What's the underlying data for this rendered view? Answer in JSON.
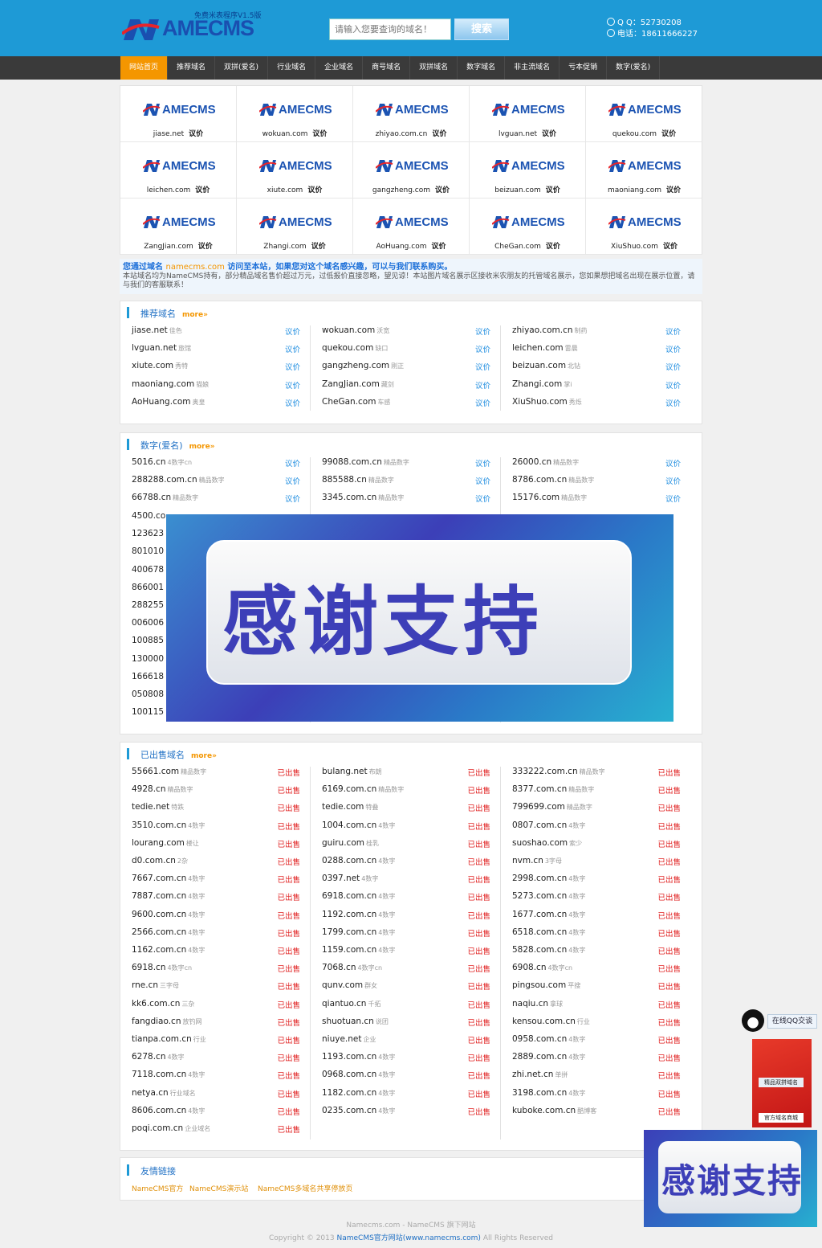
{
  "header": {
    "logo_sub": "免费米表程序V1.5版",
    "logo_text": "AMECMS",
    "search_placeholder": "请输入您要查询的域名！",
    "search_button": "搜索",
    "qq": "Q Q：52730208",
    "phone": "电话：18611666227"
  },
  "nav": [
    "网站首页",
    "推荐域名",
    "双拼(爱名)",
    "行业域名",
    "企业域名",
    "商号域名",
    "双拼域名",
    "数字域名",
    "非主流域名",
    "亏本促销",
    "数字(爱名)"
  ],
  "featured_logo": "AMECMS",
  "featured_price": "议价",
  "featured": [
    "jiase.net",
    "wokuan.com",
    "zhiyao.com.cn",
    "lvguan.net",
    "quekou.com",
    "leichen.com",
    "xiute.com",
    "gangzheng.com",
    "beizuan.com",
    "maoniang.com",
    "ZangJian.com",
    "Zhangi.com",
    "AoHuang.com",
    "CheGan.com",
    "XiuShuo.com"
  ],
  "notice": {
    "l1_a": "您通过域名",
    "l1_hl": "namecms.com",
    "l1_b": "访问至本站，如果您对这个域名感兴趣，可以与我们联系购买。",
    "l2": "本站域名均为NameCMS持有，部分精品域名售价超过万元，过低报价直接忽略，望见谅！本站图片域名展示区接收米农朋友的托管域名展示，您如果想把域名出现在展示位置，请与我们的客服联系！"
  },
  "recommended": {
    "title": "推荐域名",
    "more": "more»",
    "price": "议价",
    "rows": [
      [
        "jiase.net",
        "佳色",
        "wokuan.com",
        "沃宽",
        "zhiyao.com.cn",
        "制药"
      ],
      [
        "lvguan.net",
        "旅馆",
        "quekou.com",
        "缺口",
        "leichen.com",
        "雷晨"
      ],
      [
        "xiute.com",
        "秀特",
        "gangzheng.com",
        "刚正",
        "beizuan.com",
        "北钻"
      ],
      [
        "maoniang.com",
        "猫娘",
        "ZangJian.com",
        "藏剑",
        "Zhangi.com",
        "掌i"
      ],
      [
        "AoHuang.com",
        "奥皇",
        "CheGan.com",
        "车感",
        "XiuShuo.com",
        "秀烁"
      ]
    ]
  },
  "numeric": {
    "title": "数字(爱名)",
    "more": "more»",
    "price": "议价",
    "rows": [
      [
        "5016.cn",
        "4数字cn",
        "99088.com.cn",
        "精品数字",
        "26000.cn",
        "精品数字"
      ],
      [
        "288288.com.cn",
        "精品数字",
        "885588.cn",
        "精品数字",
        "8786.com.cn",
        "精品数字"
      ],
      [
        "66788.cn",
        "精品数字",
        "3345.com.cn",
        "精品数字",
        "15176.com",
        "精品数字"
      ]
    ],
    "partial": [
      "4500.co",
      "123623",
      "801010",
      "400678",
      "866001",
      "288255",
      "006006",
      "100885",
      "130000",
      "166618",
      "050808",
      "100115"
    ]
  },
  "overlay_text": "感谢支持",
  "sold": {
    "title": "已出售域名",
    "more": "more»",
    "status": "已出售",
    "col1": [
      [
        "55661.com",
        "精品数字"
      ],
      [
        "4928.cn",
        "精品数字"
      ],
      [
        "tedie.net",
        "特跌"
      ],
      [
        "3510.com.cn",
        "4数字"
      ],
      [
        "lourang.com",
        "楼让"
      ],
      [
        "d0.com.cn",
        "2杂"
      ],
      [
        "7667.com.cn",
        "4数字"
      ],
      [
        "7887.com.cn",
        "4数字"
      ],
      [
        "9600.com.cn",
        "4数字"
      ],
      [
        "2566.com.cn",
        "4数字"
      ],
      [
        "1162.com.cn",
        "4数字"
      ],
      [
        "6918.cn",
        "4数字cn"
      ],
      [
        "rne.cn",
        "三字母"
      ],
      [
        "kk6.com.cn",
        "三杂"
      ],
      [
        "fangdiao.cn",
        "放钓网"
      ],
      [
        "tianpa.com.cn",
        "行业"
      ],
      [
        "6278.cn",
        "4数字"
      ],
      [
        "7118.com.cn",
        "4数字"
      ],
      [
        "netya.cn",
        "行业域名"
      ],
      [
        "8606.com.cn",
        "4数字"
      ],
      [
        "poqi.com.cn",
        "企业域名"
      ]
    ],
    "col2": [
      [
        "bulang.net",
        "布朗"
      ],
      [
        "6169.com.cn",
        "精品数字"
      ],
      [
        "tedie.com",
        "特叠"
      ],
      [
        "1004.com.cn",
        "4数字"
      ],
      [
        "guiru.com",
        "桂乳"
      ],
      [
        "0288.com.cn",
        "4数字"
      ],
      [
        "0397.net",
        "4数字"
      ],
      [
        "6918.com.cn",
        "4数字"
      ],
      [
        "1192.com.cn",
        "4数字"
      ],
      [
        "1799.com.cn",
        "4数字"
      ],
      [
        "1159.com.cn",
        "4数字"
      ],
      [
        "7068.cn",
        "4数字cn"
      ],
      [
        "qunv.com",
        "群女"
      ],
      [
        "qiantuo.cn",
        "千拓"
      ],
      [
        "shuotuan.cn",
        "说团"
      ],
      [
        "niuye.net",
        "企业"
      ],
      [
        "1193.com.cn",
        "4数字"
      ],
      [
        "0968.com.cn",
        "4数字"
      ],
      [
        "1182.com.cn",
        "4数字"
      ],
      [
        "0235.com.cn",
        "4数字"
      ]
    ],
    "col3": [
      [
        "333222.com.cn",
        "精品数字"
      ],
      [
        "8377.com.cn",
        "精品数字"
      ],
      [
        "799699.com",
        "精品数字"
      ],
      [
        "0807.com.cn",
        "4数字"
      ],
      [
        "suoshao.com",
        "索少"
      ],
      [
        "nvm.cn",
        "3字母"
      ],
      [
        "2998.com.cn",
        "4数字"
      ],
      [
        "5273.com.cn",
        "4数字"
      ],
      [
        "1677.com.cn",
        "4数字"
      ],
      [
        "6518.com.cn",
        "4数字"
      ],
      [
        "5828.com.cn",
        "4数字"
      ],
      [
        "6908.cn",
        "4数字cn"
      ],
      [
        "pingsou.com",
        "平搜"
      ],
      [
        "naqiu.cn",
        "拿球"
      ],
      [
        "kensou.com.cn",
        "行业"
      ],
      [
        "0958.com.cn",
        "4数字"
      ],
      [
        "2889.com.cn",
        "4数字"
      ],
      [
        "zhi.net.cn",
        "单拼"
      ],
      [
        "3198.com.cn",
        "4数字"
      ],
      [
        "kuboke.com.cn",
        "酷博客"
      ]
    ]
  },
  "links": {
    "title": "友情链接",
    "items": [
      "NameCMS官方",
      "NameCMS演示站",
      "NameCMS多域名共享停放页"
    ]
  },
  "footer": {
    "l1": "Namecms.com - NameCMS 旗下网站",
    "l2_a": "Copyright © 2013",
    "l2_hl": "NameCMS官方网站(www.namecms.com)",
    "l2_b": "All Rights Reserved"
  },
  "side": {
    "qq_label": "在线QQ交谈",
    "ban1": "精品双拼域名",
    "ban2": "官方域名商城",
    "popup": "感谢支持"
  },
  "colors": {
    "header": "#1e9ad6",
    "nav": "#3a3a3a",
    "active": "#f49600",
    "price": "#1e8de0",
    "sold": "#e02020"
  }
}
